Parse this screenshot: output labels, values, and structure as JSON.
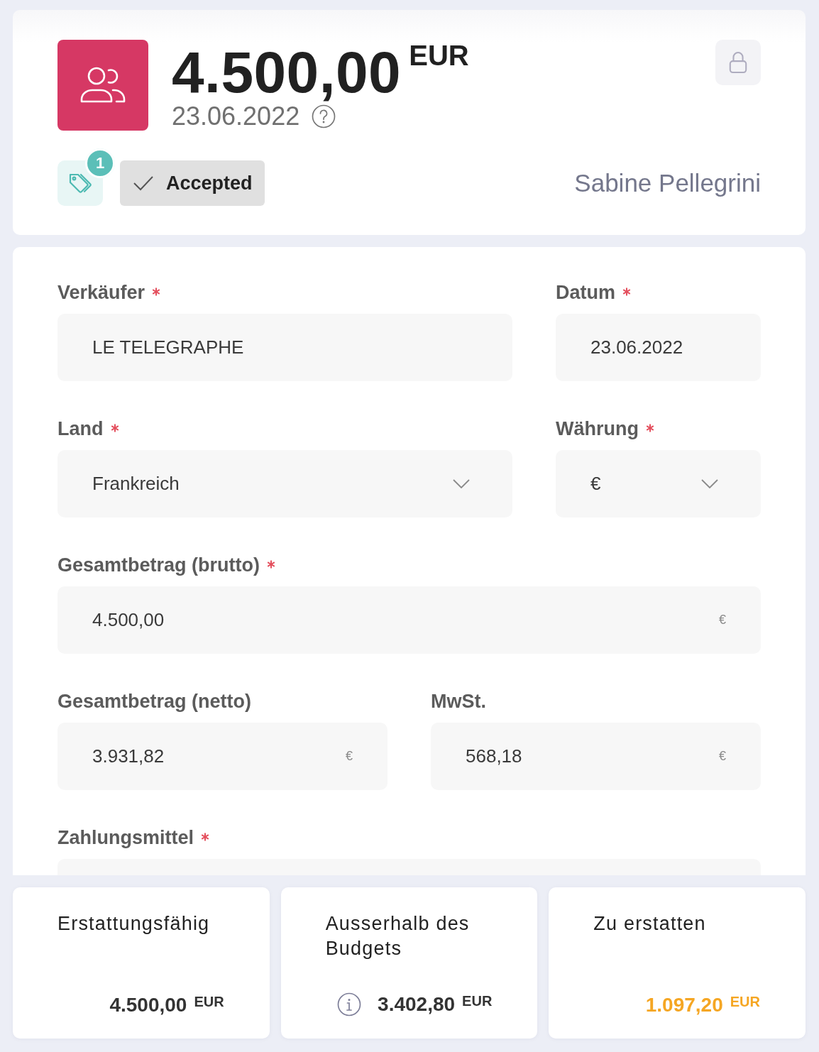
{
  "header": {
    "amount": "4.500,00",
    "currency": "EUR",
    "date": "23.06.2022",
    "tag_count": "1",
    "status": "Accepted",
    "employee": "Sabine Pellegrini"
  },
  "form": {
    "rows": [
      [
        {
          "label": "Verkäufer",
          "required": true,
          "kind": "text",
          "value": "LE TELEGRAPHE"
        },
        {
          "label": "Datum",
          "required": true,
          "kind": "text",
          "value": "23.06.2022"
        }
      ],
      [
        {
          "label": "Land",
          "required": true,
          "kind": "select",
          "value": "Frankreich"
        },
        {
          "label": "Währung",
          "required": true,
          "kind": "select",
          "value": "€"
        }
      ],
      [
        {
          "label": "Gesamtbetrag (brutto)",
          "required": true,
          "kind": "amount",
          "value": "4.500,00",
          "suffix": "€"
        }
      ],
      [
        {
          "label": "Gesamtbetrag (netto)",
          "required": false,
          "kind": "amount",
          "value": "3.931,82",
          "suffix": "€"
        },
        {
          "label": "MwSt.",
          "required": false,
          "kind": "amount",
          "value": "568,18",
          "suffix": "€"
        }
      ],
      [
        {
          "label": "Zahlungsmittel",
          "required": true,
          "kind": "text"
        }
      ]
    ]
  },
  "summary": [
    {
      "label": "Erstattungsfähig",
      "info": false,
      "amount": "4.500,00",
      "currency": "EUR",
      "color": "#333333"
    },
    {
      "label": "Ausserhalb des Budgets",
      "info": true,
      "amount": "3.402,80",
      "currency": "EUR",
      "color": "#333333"
    },
    {
      "label": "Zu erstatten",
      "info": false,
      "amount": "1.097,20",
      "currency": "EUR",
      "color": "#f5a623"
    }
  ]
}
